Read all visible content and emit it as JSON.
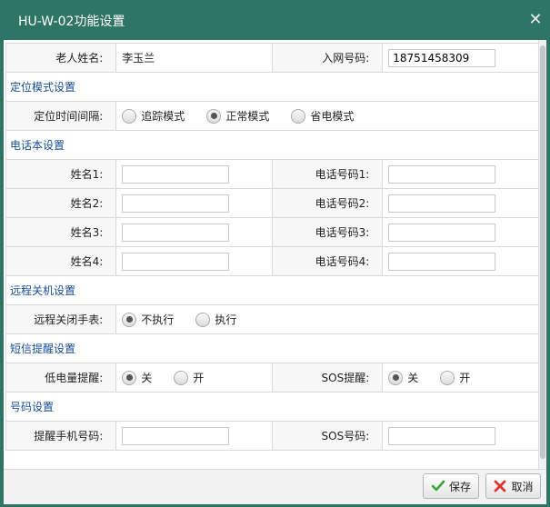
{
  "window": {
    "title": "HU-W-02功能设置"
  },
  "basic": {
    "name_label": "老人姓名:",
    "name_value": "李玉兰",
    "phone_label": "入网号码:",
    "phone_value": "18751458309"
  },
  "location": {
    "section": "定位模式设置",
    "interval_label": "定位时间间隔:",
    "options": [
      "追踪模式",
      "正常模式",
      "省电模式"
    ],
    "selected": "正常模式"
  },
  "phonebook": {
    "section": "电话本设置",
    "rows": [
      {
        "name_label": "姓名1:",
        "phone_label": "电话号码1:"
      },
      {
        "name_label": "姓名2:",
        "phone_label": "电话号码2:"
      },
      {
        "name_label": "姓名3:",
        "phone_label": "电话号码3:"
      },
      {
        "name_label": "姓名4:",
        "phone_label": "电话号码4:"
      }
    ]
  },
  "shutdown": {
    "section": "远程关机设置",
    "label": "远程关闭手表:",
    "options": [
      "不执行",
      "执行"
    ],
    "selected": "不执行"
  },
  "sms": {
    "section": "短信提醒设置",
    "low_battery_label": "低电量提醒:",
    "sos_label": "SOS提醒:",
    "options": [
      "关",
      "开"
    ],
    "low_selected": "关",
    "sos_selected": "关"
  },
  "numbers": {
    "section": "号码设置",
    "reminder_label": "提醒手机号码:",
    "sos_label": "SOS号码:"
  },
  "buttons": {
    "save": "保存",
    "cancel": "取消"
  },
  "colors": {
    "titlebar": "#2f7565",
    "section_text": "#174e97",
    "save_icon": "#3aa33a",
    "cancel_icon": "#d9372e"
  }
}
